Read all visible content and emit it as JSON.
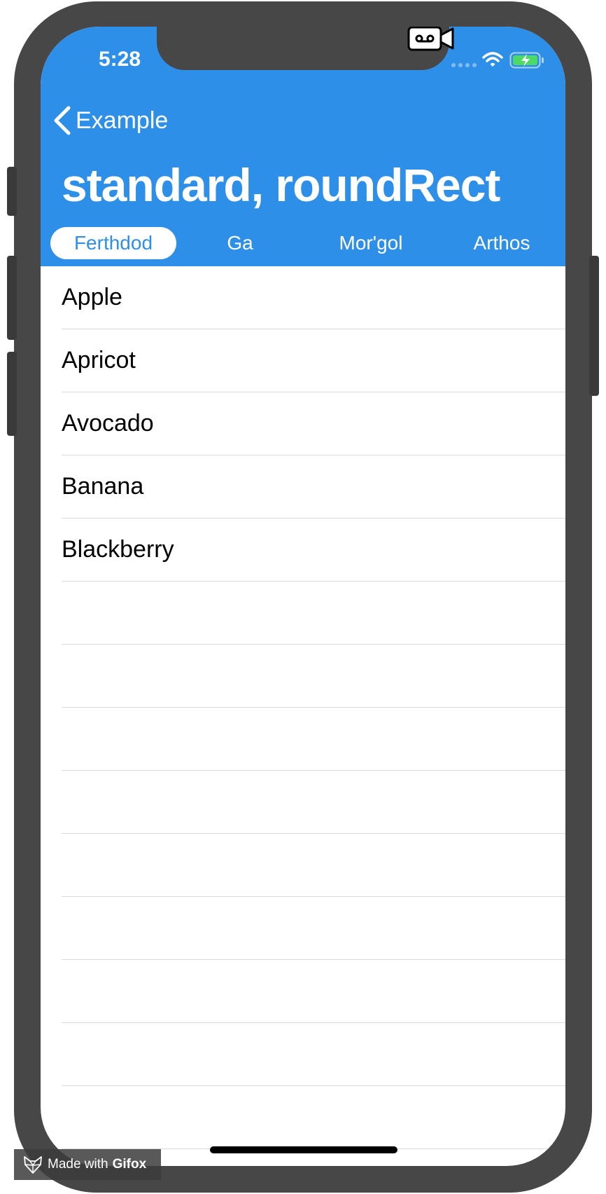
{
  "status_bar": {
    "time": "5:28"
  },
  "nav": {
    "back_label": "Example",
    "title": "standard, roundRect"
  },
  "tabs": [
    {
      "label": "Ferthdod",
      "selected": true
    },
    {
      "label": "Ga",
      "selected": false
    },
    {
      "label": "Mor'gol",
      "selected": false
    },
    {
      "label": "Arthos",
      "selected": false
    }
  ],
  "list": {
    "items": [
      "Apple",
      "Apricot",
      "Avocado",
      "Banana",
      "Blackberry",
      "",
      "",
      "",
      "",
      "",
      "",
      "",
      "",
      ""
    ]
  },
  "watermark": {
    "prefix": "Made with",
    "brand": "Gifox"
  },
  "colors": {
    "header_bg": "#2e8fe8",
    "frame": "#474747",
    "battery": "#4cd964"
  },
  "icons": [
    "camera-icon",
    "signal-icon",
    "wifi-icon",
    "battery-charging-icon",
    "back-chevron-icon",
    "gifox-logo-icon"
  ]
}
